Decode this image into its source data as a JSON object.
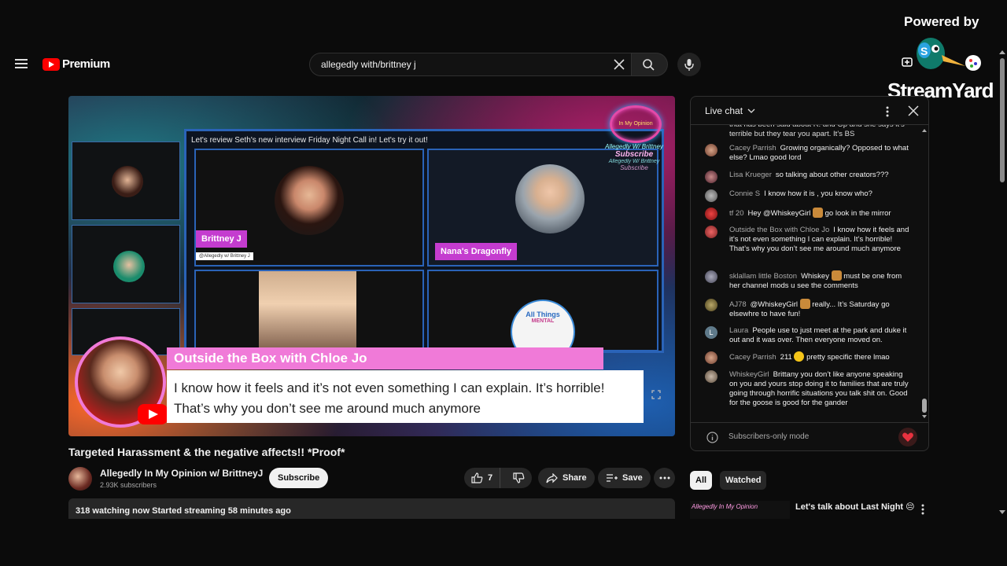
{
  "header": {
    "brand_label": "Premium",
    "search_value": "allegedly with/brittney j"
  },
  "streamyard": {
    "powered_label": "Powered by",
    "brand": "StreamYard"
  },
  "video": {
    "stage_title": "Let's review Seth's new interview Friday Night Call in! Let's try it out!",
    "name_tag_1": "Brittney J",
    "name_sub_1": "@Allegedly w/ Brittney J",
    "name_tag_2": "Nana's Dragonfly",
    "banner_name": "Outside the Box with Chloe Jo",
    "banner_text": "I know how it feels and it’s not even something I can explain. It’s horrible! That’s why you don’t see me around much anymore",
    "logo_text_1": "Allegedly W/ Brittney",
    "logo_text_2": "Subscribe",
    "logo_text_3": "Allegedly W/ Brittney",
    "logo_text_4": "Subscribe",
    "logo_heart": "In My Opinion",
    "all_things_label": "All Things",
    "all_things_sub": "MENTAL"
  },
  "meta": {
    "title": "Targeted Harassment & the negative affects!! *Proof*",
    "channel_name": "Allegedly In My Opinion w/ BrittneyJ",
    "subscribers": "2.93K subscribers",
    "subscribe_label": "Subscribe",
    "like_count": "7",
    "share_label": "Share",
    "save_label": "Save",
    "watching": "318 watching now  Started streaming 58 minutes ago"
  },
  "chat": {
    "title": "Live chat",
    "footer_label": "Subscribers-only mode",
    "partial_top": "that has been said about R. and Op and she says it’s terrible but they tear you apart. It’s BS",
    "messages": [
      {
        "author": "Cacey Parrish",
        "text": "Growing organically? Opposed to what else? Lmao good lord"
      },
      {
        "author": "Lisa Krueger",
        "text": "so talking about other creators???"
      },
      {
        "author": "Connie S",
        "text": "I know how it is , you know who?"
      },
      {
        "author": "tf 20",
        "text": "Hey @WhiskeyGirl",
        "text2": "go look in the mirror"
      },
      {
        "author": "Outside the Box with Chloe Jo",
        "text": "I know how it feels and it’s not even something I can explain. It’s horrible! That’s why you don’t see me around much anymore"
      },
      {
        "author": "sklallam little Boston",
        "text": "Whiskey",
        "text2": "must be one from her channel mods u see the comments"
      },
      {
        "author": "AJ78",
        "text": "@WhiskeyGirl",
        "text2": "really... It’s Saturday go elsewhre to have fun!"
      },
      {
        "author": "Laura",
        "text": "People use to just meet at the park and duke it out and it was over. Then everyone moved on."
      },
      {
        "author": "Cacey Parrish",
        "text": "211",
        "text2": "pretty specific there lmao"
      },
      {
        "author": "WhiskeyGirl",
        "text": "Brittany you don’t like anyone speaking on you and yours stop doing it to families that are truly going through horrific situations you talk shit on. Good for the goose is good for the gander"
      }
    ],
    "avatar_letter_laura": "L"
  },
  "related": {
    "chip_all": "All",
    "chip_watched": "Watched",
    "thumb_text": "Allegedly In My Opinion",
    "rec_title": "Let's talk about Last Night 😔"
  },
  "colors": {
    "accent_red": "#ff0000",
    "banner_pink": "#f07ad8",
    "tag_purple": "#c43ccf",
    "stage_blue": "#2a63b8"
  }
}
